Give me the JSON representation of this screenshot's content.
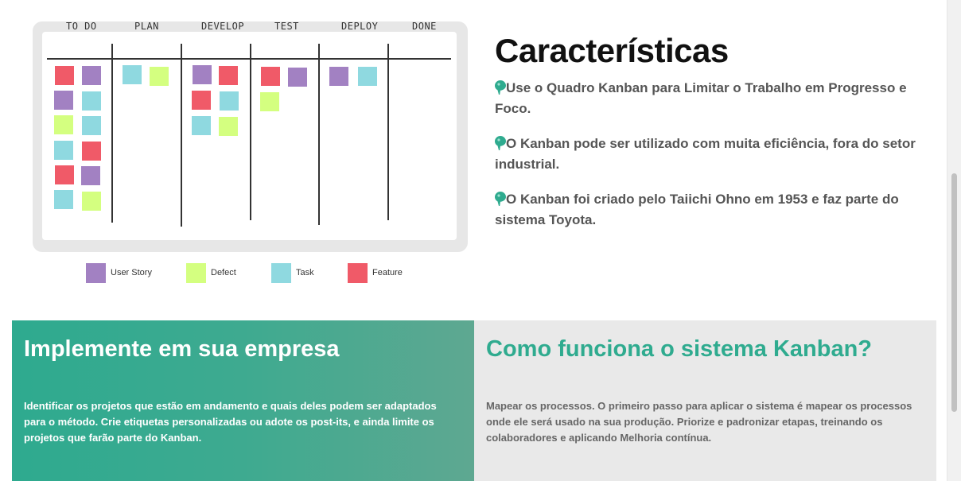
{
  "board": {
    "columns": [
      "TO DO",
      "PLAN",
      "DEVELOP",
      "TEST",
      "DEPLOY",
      "DONE"
    ]
  },
  "legend": {
    "items": [
      {
        "label": "User Story",
        "color": "#a281c2"
      },
      {
        "label": "Defect",
        "color": "#d4ff80"
      },
      {
        "label": "Task",
        "color": "#8fd9e0"
      },
      {
        "label": "Feature",
        "color": "#f05a68"
      }
    ]
  },
  "characteristics": {
    "title": "Características",
    "items": [
      "Use o Quadro Kanban para Limitar o Trabalho em Progresso e Foco.",
      "O Kanban pode ser utilizado com muita eficiência, fora do setor industrial.",
      "O Kanban foi criado pelo Taiichi Ohno em 1953 e faz parte do sistema Toyota."
    ],
    "icon": "map-pin-icon",
    "accent": "#2fab8f"
  },
  "implement": {
    "title": "Implemente em sua empresa",
    "text": "Identificar os projetos que estão em andamento e quais deles podem ser adaptados para o método. Crie etiquetas personalizadas ou adote os post-its, e ainda limite os projetos que farão parte do Kanban."
  },
  "how": {
    "title": "Como funciona o sistema Kanban?",
    "text": "Mapear os processos. O primeiro passo para aplicar o sistema é mapear os processos onde ele será usado na sua produção. Priorize e padronizar etapas, treinando os colaboradores e aplicando Melhoria contínua."
  }
}
